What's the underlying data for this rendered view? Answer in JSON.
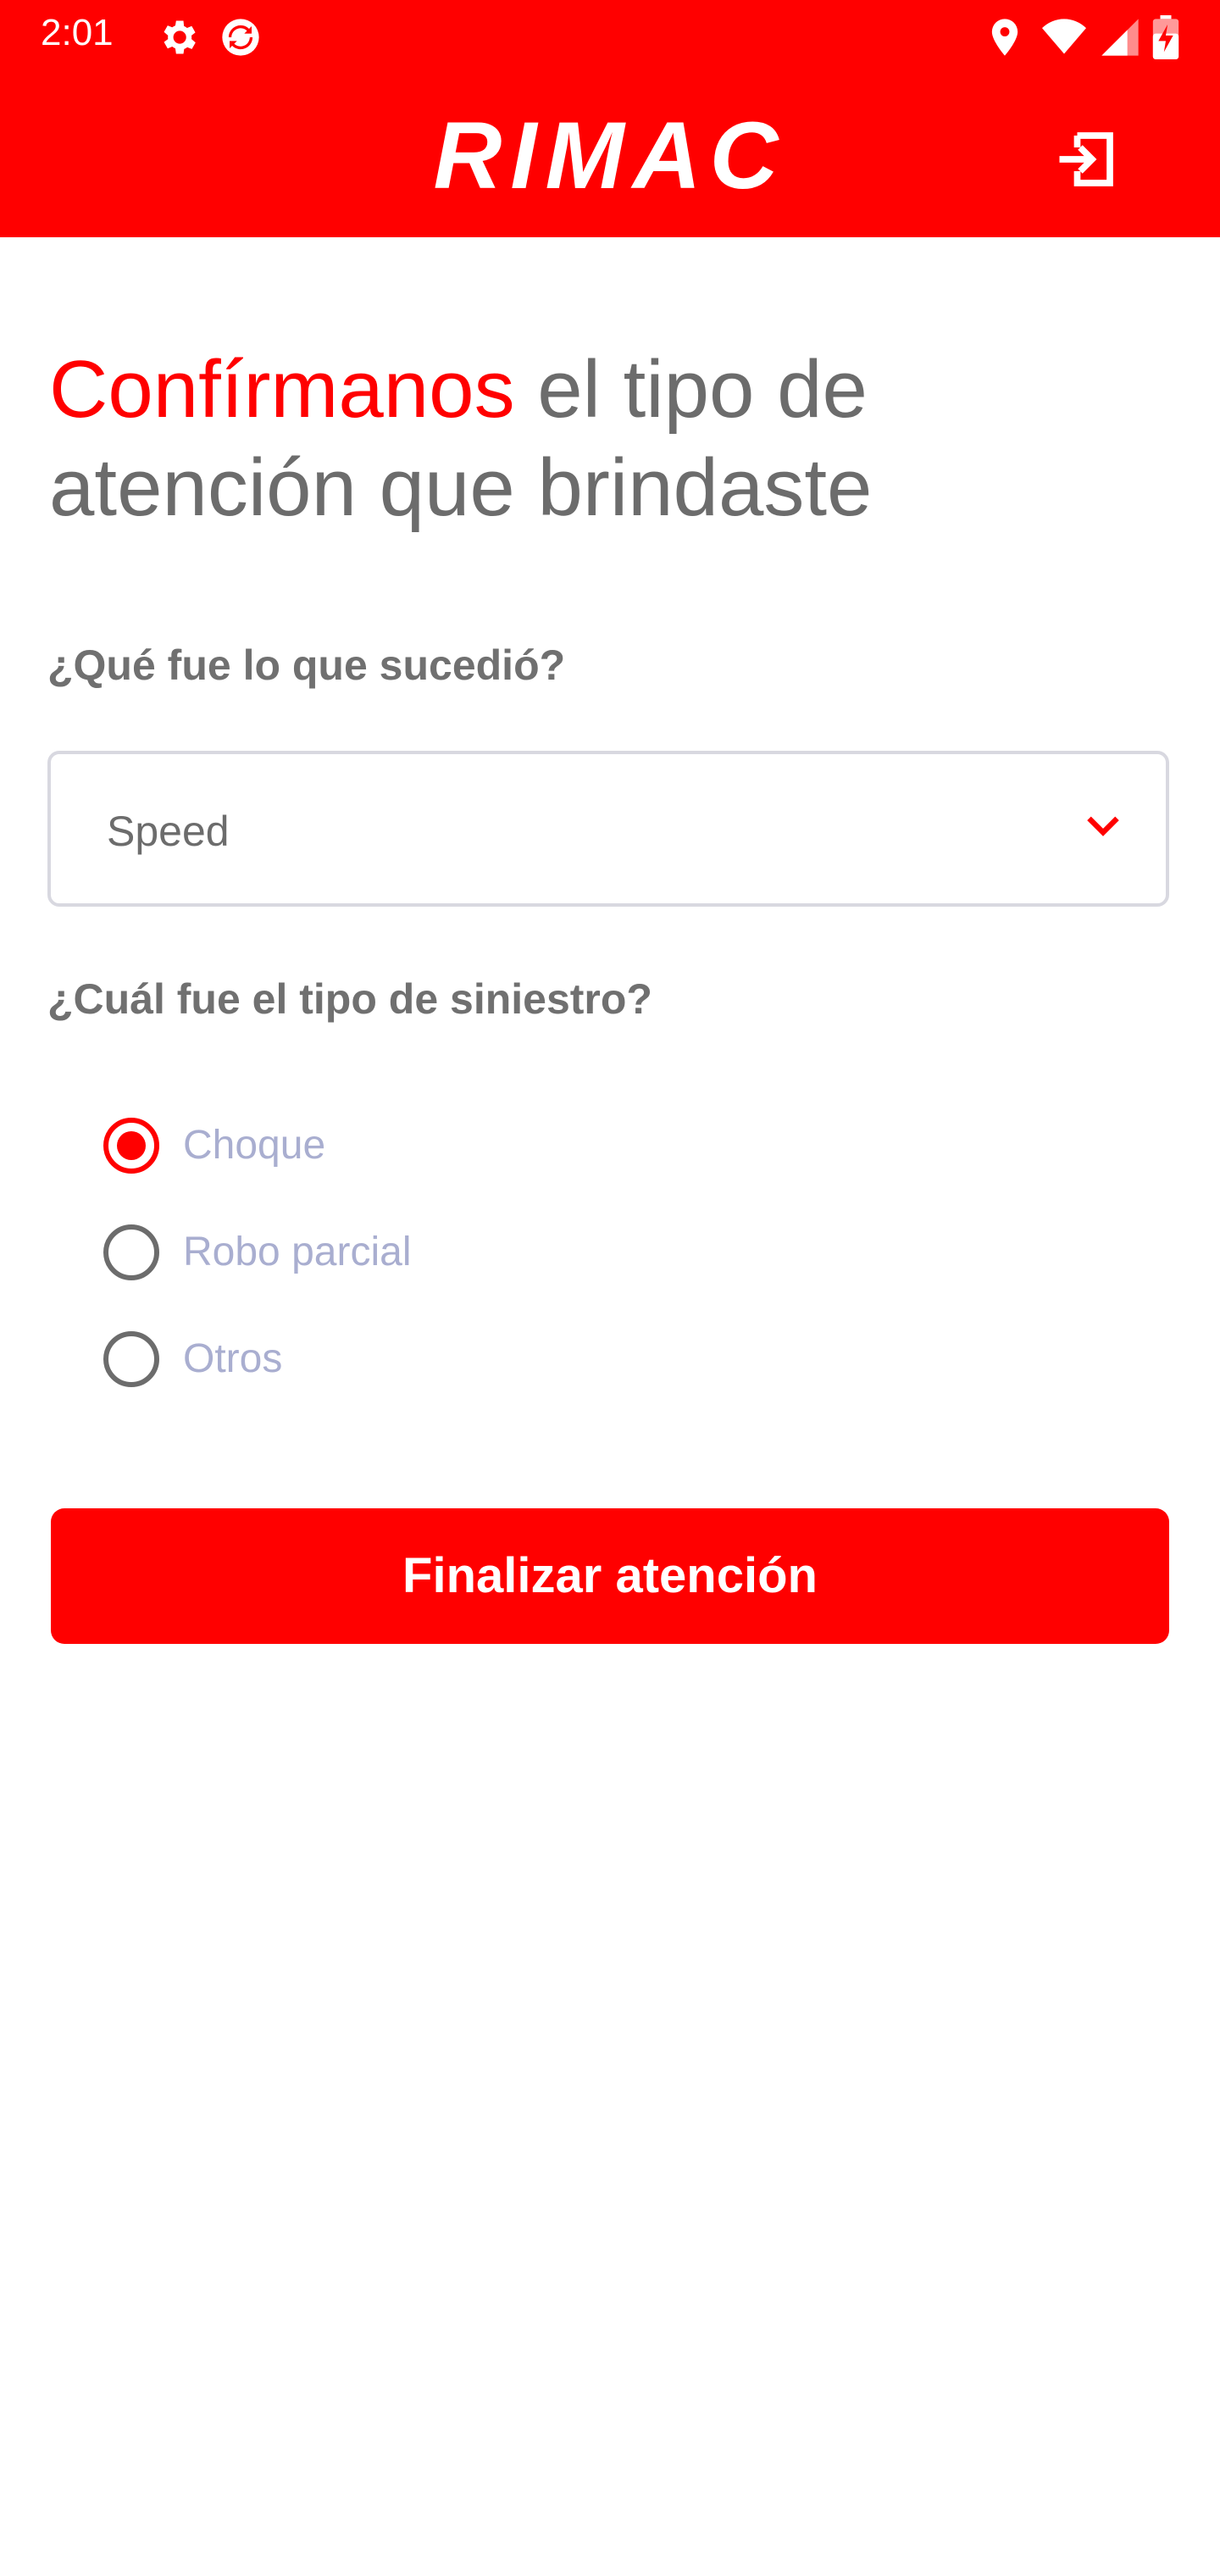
{
  "status_bar": {
    "time": "2:01",
    "icons": [
      "settings-icon",
      "sync-app-icon",
      "location-icon",
      "wifi-icon",
      "signal-icon",
      "battery-charging-icon"
    ]
  },
  "header": {
    "logo_text": "RIMAC",
    "logout_icon": "logout-icon"
  },
  "page": {
    "title_accent": "Confírmanos",
    "title_rest_1": " el tipo de",
    "title_rest_2": "atención que brindaste"
  },
  "form": {
    "question_1": "¿Qué fue lo que sucedió?",
    "select_value": "Speed",
    "question_2": "¿Cuál fue el tipo de siniestro?",
    "options": [
      {
        "label": "Choque",
        "selected": true
      },
      {
        "label": "Robo parcial",
        "selected": false
      },
      {
        "label": "Otros",
        "selected": false
      }
    ],
    "submit_label": "Finalizar atención"
  },
  "colors": {
    "accent": "#ff0000",
    "text_gray": "#6c6c6c",
    "option_text": "#a9aed0"
  }
}
